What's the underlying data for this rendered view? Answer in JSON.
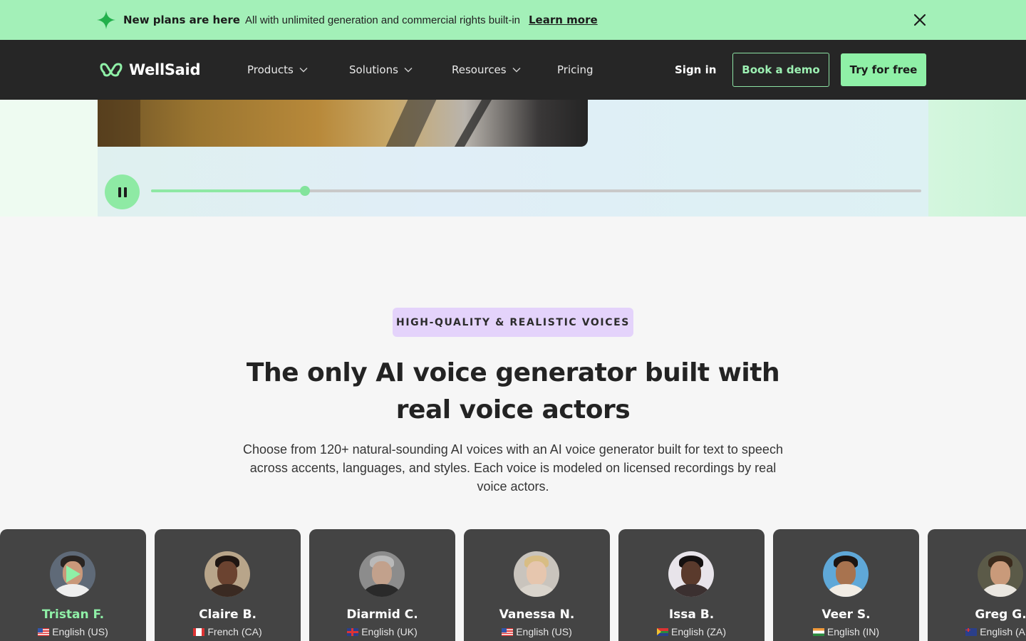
{
  "announcement": {
    "title": "New plans are here",
    "text": "All with unlimited generation and commercial rights built-in",
    "link": "Learn more"
  },
  "nav": {
    "brand": "WellSaid",
    "items": [
      {
        "label": "Products",
        "dropdown": true
      },
      {
        "label": "Solutions",
        "dropdown": true
      },
      {
        "label": "Resources",
        "dropdown": true
      },
      {
        "label": "Pricing",
        "dropdown": false
      }
    ],
    "sign_in": "Sign in",
    "book_demo": "Book a demo",
    "try_free": "Try for free"
  },
  "player": {
    "state": "playing",
    "progress_fraction": 0.2
  },
  "section": {
    "badge": "HIGH-QUALITY & REALISTIC VOICES",
    "heading_line1": "The only AI voice generator built with",
    "heading_line2": "real voice actors",
    "description": "Choose from 120+ natural-sounding AI voices with an AI voice generator built for text to speech across accents, languages, and styles. Each voice is modeled on licensed recordings by real voice actors."
  },
  "voices": [
    {
      "name": "Tristan F.",
      "language": "English (US)",
      "flag": "us-flag-icon",
      "active": true
    },
    {
      "name": "Claire B.",
      "language": "French (CA)",
      "flag": "ca-flag-icon",
      "active": false
    },
    {
      "name": "Diarmid C.",
      "language": "English (UK)",
      "flag": "uk-flag-icon",
      "active": false
    },
    {
      "name": "Vanessa N.",
      "language": "English (US)",
      "flag": "us-flag-icon",
      "active": false
    },
    {
      "name": "Issa B.",
      "language": "English (ZA)",
      "flag": "za-flag-icon",
      "active": false
    },
    {
      "name": "Veer S.",
      "language": "English (IN)",
      "flag": "in-flag-icon",
      "active": false
    },
    {
      "name": "Greg G.",
      "language": "English (AU)",
      "flag": "au-flag-icon",
      "active": false
    }
  ],
  "colors": {
    "announcement_bg": "#a3f0b8",
    "nav_bg": "#262626",
    "accent_green": "#8ff0a7",
    "badge_bg": "#e4d3fb",
    "card_bg": "#444444"
  }
}
